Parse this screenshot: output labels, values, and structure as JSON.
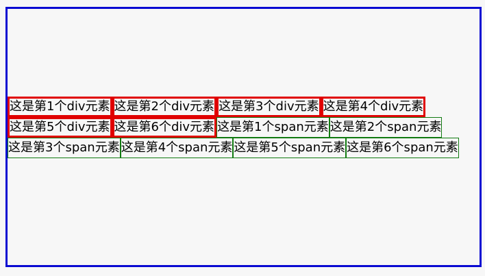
{
  "items": [
    {
      "type": "div",
      "text": "这是第1个div元素"
    },
    {
      "type": "div",
      "text": "这是第2个div元素"
    },
    {
      "type": "div",
      "text": "这是第3个div元素"
    },
    {
      "type": "div",
      "text": "这是第4个div元素"
    },
    {
      "type": "div",
      "text": "这是第5个div元素"
    },
    {
      "type": "div",
      "text": "这是第6个div元素"
    },
    {
      "type": "span",
      "text": "这是第1个span元素"
    },
    {
      "type": "span",
      "text": "这是第2个span元素"
    },
    {
      "type": "span",
      "text": "这是第3个span元素"
    },
    {
      "type": "span",
      "text": "这是第4个span元素"
    },
    {
      "type": "span",
      "text": "这是第5个span元素"
    },
    {
      "type": "span",
      "text": "这是第6个span元素"
    }
  ],
  "colors": {
    "container_border": "#0a0ad2",
    "div_border": "#e00000",
    "span_border": "#117a11",
    "background": "#f7f7f7"
  }
}
